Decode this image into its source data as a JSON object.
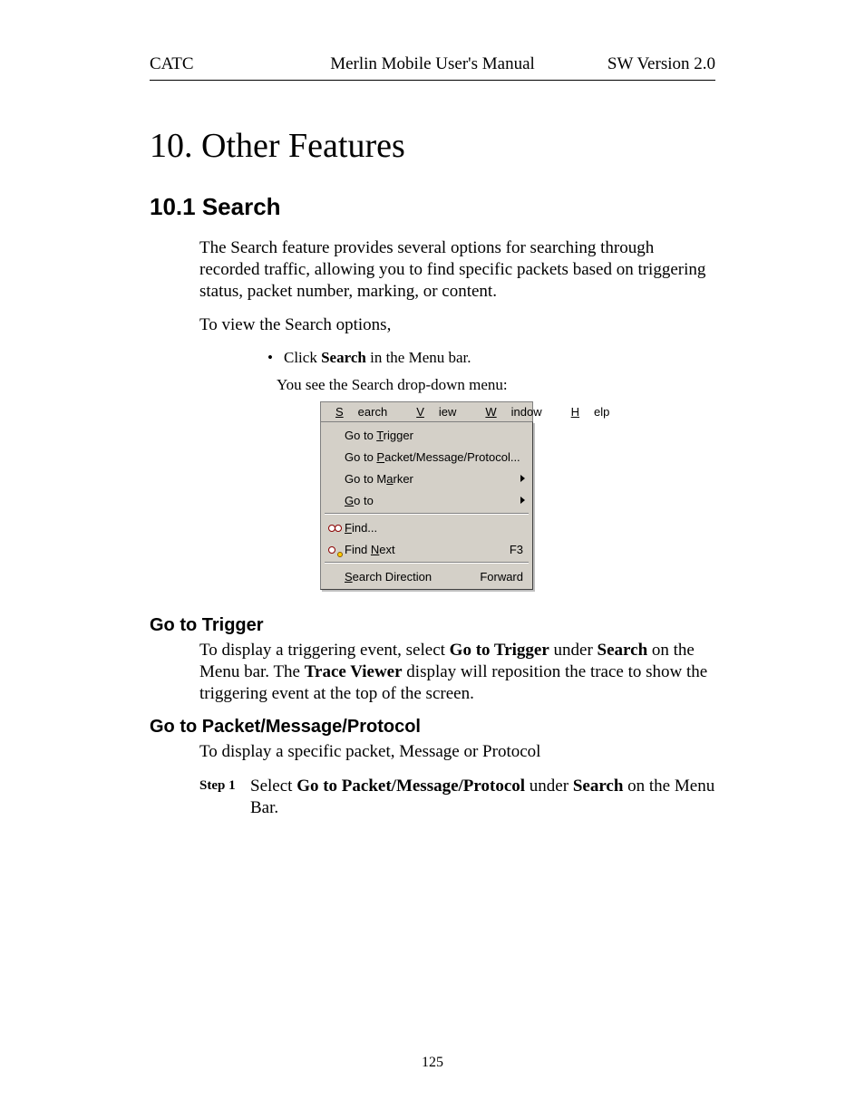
{
  "header": {
    "left": "CATC",
    "center": "Merlin Mobile User's Manual",
    "right": "SW Version 2.0"
  },
  "chapter_title": "10. Other Features",
  "section_title": "10.1  Search",
  "intro_para": "The Search feature provides several options for searching through recorded traffic, allowing you to find specific packets based on triggering status, packet number, marking, or content.",
  "view_line": "To view the Search options,",
  "bullet_pre": "Click ",
  "bullet_bold": "Search",
  "bullet_post": " in the Menu bar.",
  "caption": "You see the Search drop-down menu:",
  "menubar": {
    "search_u": "S",
    "search_rest": "earch",
    "view_u": "V",
    "view_rest": "iew",
    "window_u": "W",
    "window_rest": "indow",
    "help_u": "H",
    "help_rest": "elp"
  },
  "menu": {
    "trigger_pre": "Go to ",
    "trigger_u": "T",
    "trigger_post": "rigger",
    "packet_pre": "Go to ",
    "packet_u": "P",
    "packet_post": "acket/Message/Protocol...",
    "marker_pre": "Go to M",
    "marker_u": "a",
    "marker_post": "rker",
    "goto_u": "G",
    "goto_post": "o to",
    "find_u": "F",
    "find_post": "ind...",
    "findnext_pre": "Find ",
    "findnext_u": "N",
    "findnext_post": "ext",
    "findnext_accel": "F3",
    "dir_u": "S",
    "dir_post": "earch Direction",
    "dir_value": "Forward"
  },
  "sub1": {
    "heading": "Go to Trigger",
    "t1": "To display a triggering event, select ",
    "b1": "Go to Trigger",
    "t2": " under ",
    "b2": "Search",
    "t3": " on the Menu bar.  The ",
    "b3": "Trace Viewer",
    "t4": " display will reposition the trace to show the triggering event at the top of the screen."
  },
  "sub2": {
    "heading": "Go to Packet/Message/Protocol",
    "intro": "To display a specific packet, Message or Protocol",
    "step_label": "Step 1",
    "s1": "Select ",
    "sb1": "Go to Packet/Message/Protocol",
    "s2": " under ",
    "sb2": "Search",
    "s3": " on the Menu Bar."
  },
  "page_number": "125"
}
